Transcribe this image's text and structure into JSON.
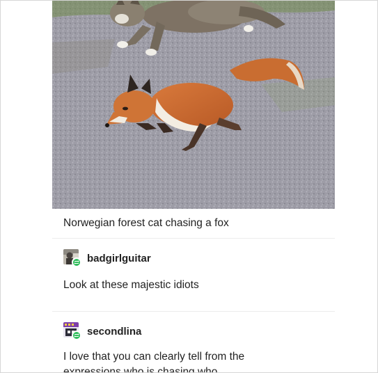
{
  "post": {
    "caption": "Norwegian forest cat chasing a fox",
    "reblogs": [
      {
        "username": "badgirlguitar",
        "avatar": "photo-avatar",
        "badge": "reblog-icon",
        "text": "Look at these majestic idiots"
      },
      {
        "username": "secondlina",
        "avatar": "pixel-art-avatar",
        "badge": "reblog-icon",
        "text": "I love that you can clearly tell from the expressions who is chasing who."
      }
    ]
  },
  "colors": {
    "badge_green": "#2fbd5b",
    "text": "#222222",
    "divider": "#ececec"
  }
}
